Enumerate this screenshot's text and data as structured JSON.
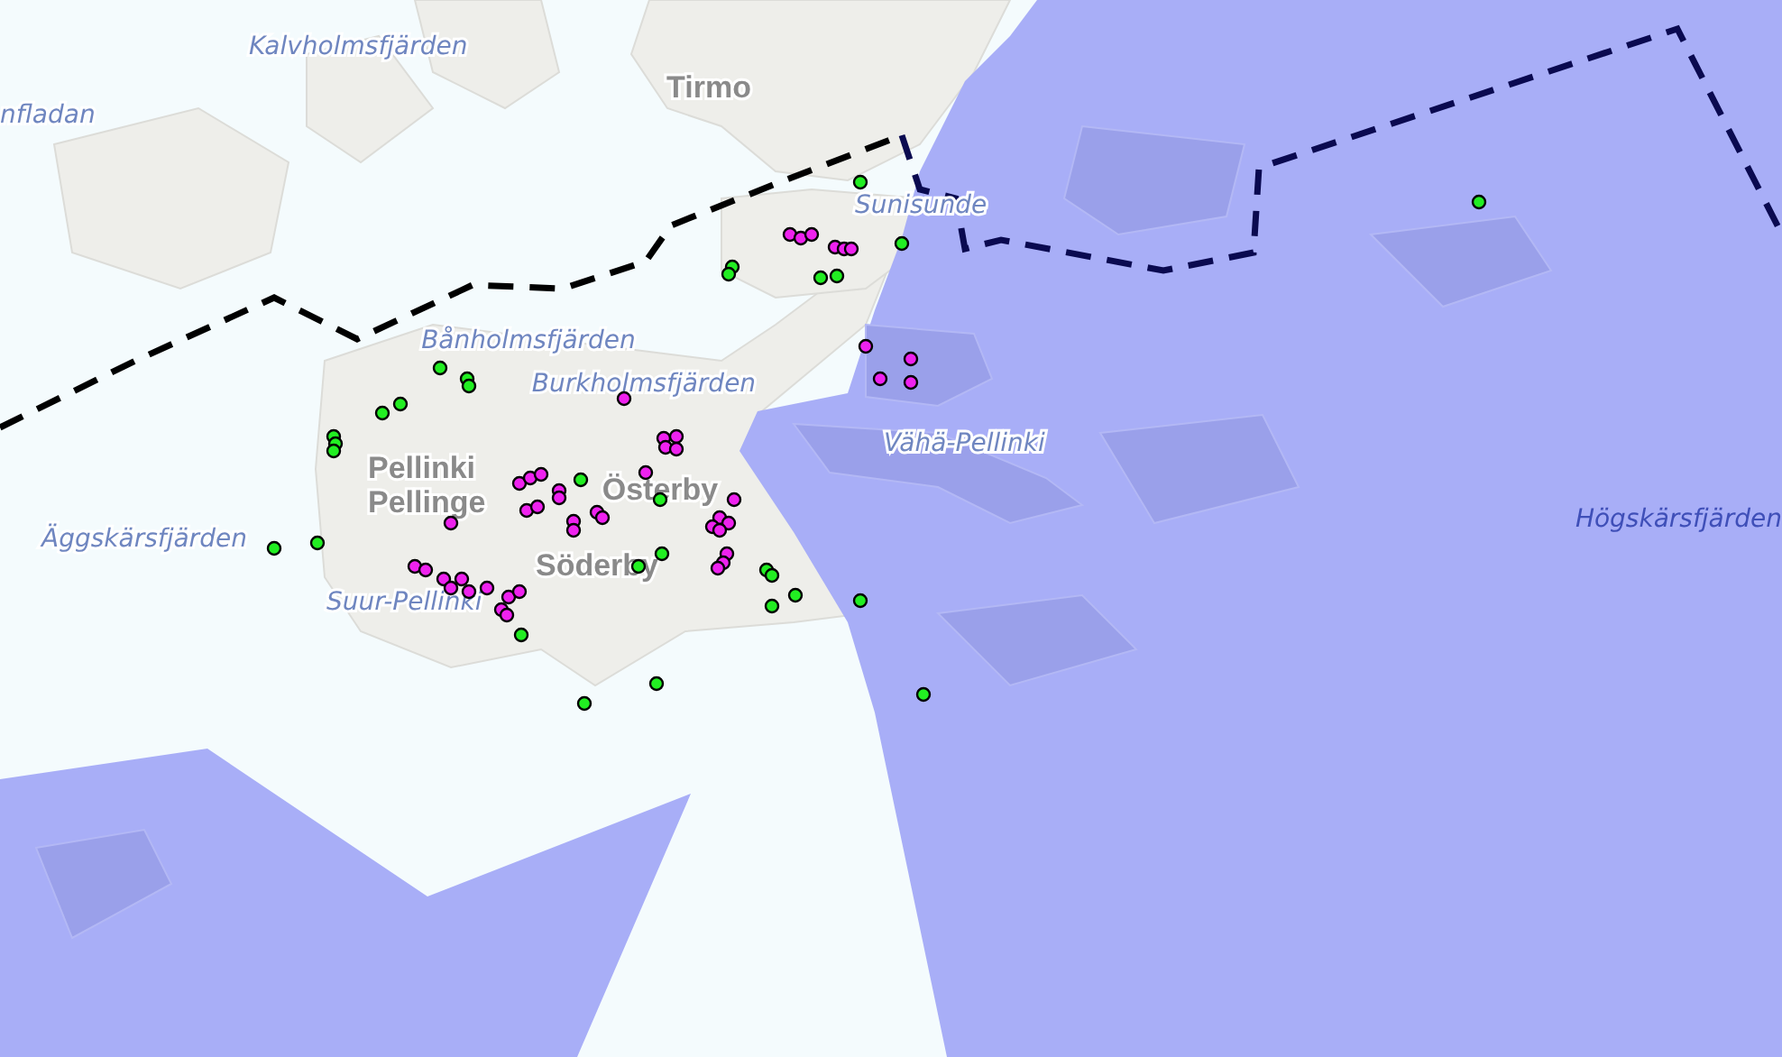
{
  "map": {
    "labels": [
      {
        "kind": "water",
        "text": "Kalvholmsfjärden"
      },
      {
        "kind": "water",
        "text": "nfladan"
      },
      {
        "kind": "place",
        "text": "Tirmo"
      },
      {
        "kind": "water",
        "text": "Sunisunde"
      },
      {
        "kind": "water",
        "text": "Bånholmsfjärden"
      },
      {
        "kind": "water",
        "text": "Burkholmsfjärden"
      },
      {
        "kind": "water",
        "text": "Vähä-Pellinki"
      },
      {
        "kind": "place",
        "text": "Pellinki"
      },
      {
        "kind": "place",
        "text": "Pellinge"
      },
      {
        "kind": "place",
        "text": "Österby"
      },
      {
        "kind": "place",
        "text": "Söderby"
      },
      {
        "kind": "water",
        "text": "Suur-Pellinki"
      },
      {
        "kind": "water",
        "text": "Äggskärsfjärden"
      },
      {
        "kind": "water",
        "text": "Högskärsfjärden"
      }
    ],
    "points": [
      {
        "color": "#22ee22"
      },
      {
        "color": "#22ee22"
      },
      {
        "color": "#22ee22"
      },
      {
        "color": "#22ee22"
      },
      {
        "color": "#22ee22"
      },
      {
        "color": "#22ee22"
      },
      {
        "color": "#22ee22"
      },
      {
        "color": "#22ee22"
      },
      {
        "color": "#22ee22"
      },
      {
        "color": "#22ee22"
      },
      {
        "color": "#22ee22"
      },
      {
        "color": "#22ee22"
      },
      {
        "color": "#22ee22"
      },
      {
        "color": "#22ee22"
      },
      {
        "color": "#22ee22"
      },
      {
        "color": "#22ee22"
      },
      {
        "color": "#22ee22"
      },
      {
        "color": "#22ee22"
      },
      {
        "color": "#22ee22"
      },
      {
        "color": "#22ee22"
      },
      {
        "color": "#22ee22"
      },
      {
        "color": "#22ee22"
      },
      {
        "color": "#22ee22"
      },
      {
        "color": "#22ee22"
      },
      {
        "color": "#22ee22"
      },
      {
        "color": "#22ee22"
      },
      {
        "color": "#22ee22"
      },
      {
        "color": "#22ee22"
      },
      {
        "color": "#22ee22"
      },
      {
        "color": "#22ee22"
      },
      {
        "color": "#ee22ee"
      },
      {
        "color": "#ee22ee"
      },
      {
        "color": "#ee22ee"
      },
      {
        "color": "#ee22ee"
      },
      {
        "color": "#ee22ee"
      },
      {
        "color": "#ee22ee"
      },
      {
        "color": "#ee22ee"
      },
      {
        "color": "#ee22ee"
      },
      {
        "color": "#ee22ee"
      },
      {
        "color": "#ee22ee"
      },
      {
        "color": "#ee22ee"
      },
      {
        "color": "#ee22ee"
      },
      {
        "color": "#ee22ee"
      },
      {
        "color": "#ee22ee"
      },
      {
        "color": "#ee22ee"
      },
      {
        "color": "#ee22ee"
      },
      {
        "color": "#ee22ee"
      },
      {
        "color": "#ee22ee"
      },
      {
        "color": "#ee22ee"
      },
      {
        "color": "#ee22ee"
      },
      {
        "color": "#ee22ee"
      },
      {
        "color": "#ee22ee"
      },
      {
        "color": "#ee22ee"
      },
      {
        "color": "#ee22ee"
      },
      {
        "color": "#ee22ee"
      },
      {
        "color": "#ee22ee"
      },
      {
        "color": "#ee22ee"
      },
      {
        "color": "#ee22ee"
      },
      {
        "color": "#ee22ee"
      },
      {
        "color": "#ee22ee"
      },
      {
        "color": "#ee22ee"
      },
      {
        "color": "#ee22ee"
      },
      {
        "color": "#ee22ee"
      },
      {
        "color": "#ee22ee"
      },
      {
        "color": "#ee22ee"
      },
      {
        "color": "#ee22ee"
      },
      {
        "color": "#ee22ee"
      },
      {
        "color": "#ee22ee"
      },
      {
        "color": "#ee22ee"
      },
      {
        "color": "#ee22ee"
      },
      {
        "color": "#ee22ee"
      },
      {
        "color": "#ee22ee"
      },
      {
        "color": "#ee22ee"
      },
      {
        "color": "#ee22ee"
      },
      {
        "color": "#ee22ee"
      },
      {
        "color": "#ee22ee"
      },
      {
        "color": "#ee22ee"
      }
    ]
  }
}
